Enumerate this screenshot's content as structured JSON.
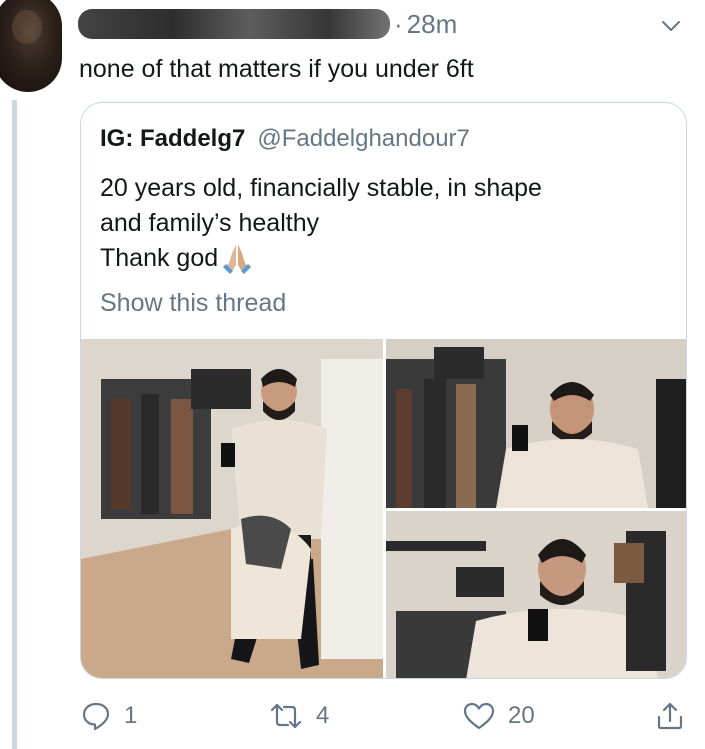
{
  "tweet": {
    "time_sep": "·",
    "timestamp": "28m",
    "text": "none of that matters if you under 6ft"
  },
  "quote": {
    "name": "IG: Faddelg7",
    "handle": "@Faddelghandour7",
    "lines": [
      "20 years old, financially stable, in shape",
      "and family’s healthy",
      "Thank god"
    ],
    "show_thread": "Show this thread",
    "emoji": "praying-hands-icon"
  },
  "actions": {
    "reply_count": "1",
    "retweet_count": "4",
    "like_count": "20"
  },
  "colors": {
    "text": "#14171a",
    "muted": "#657786",
    "border": "#ccd6dd"
  }
}
